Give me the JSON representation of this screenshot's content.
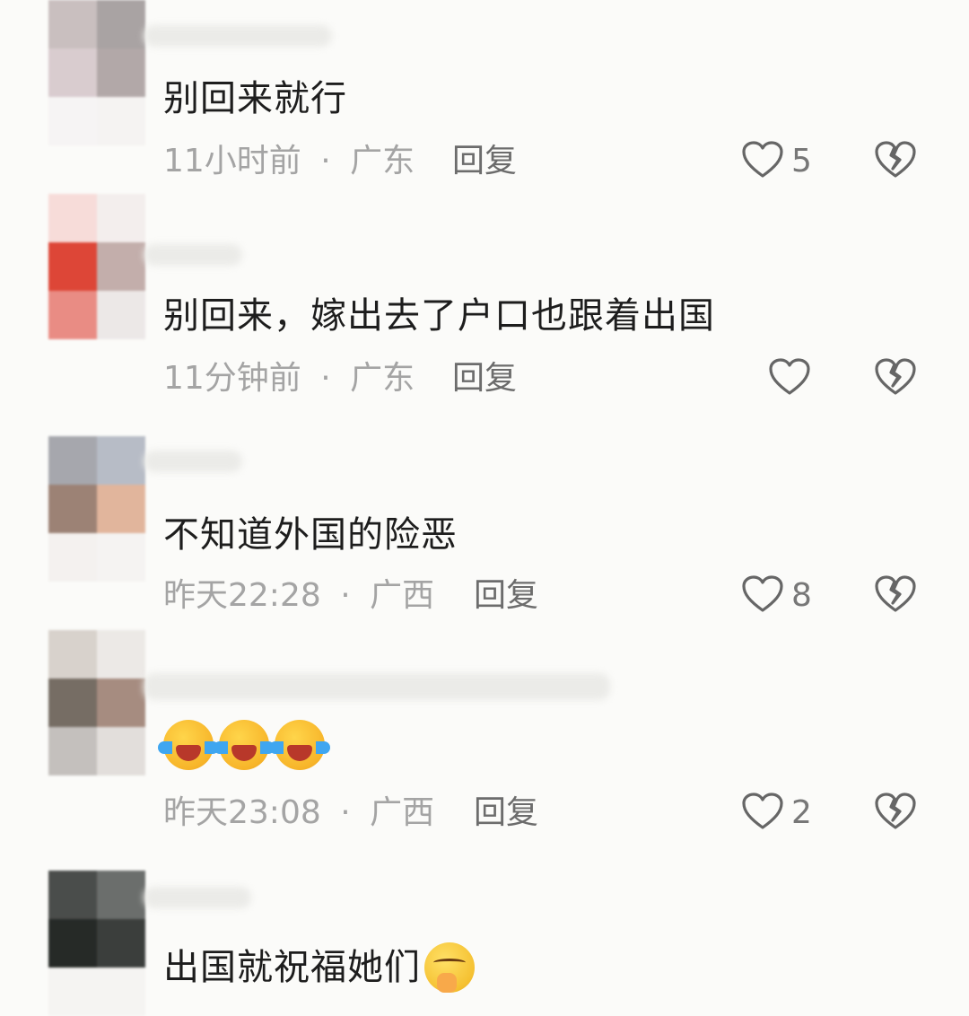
{
  "comments": [
    {
      "text": "别回来就行",
      "time": "11小时前",
      "location": "广东",
      "reply": "回复",
      "likes": "5"
    },
    {
      "text": "别回来，嫁出去了户口也跟着出国",
      "time": "11分钟前",
      "location": "广东",
      "reply": "回复",
      "likes": ""
    },
    {
      "text": "不知道外国的险恶",
      "time": "昨天22:28",
      "location": "广西",
      "reply": "回复",
      "likes": "8"
    },
    {
      "text": "",
      "time": "昨天23:08",
      "location": "广西",
      "reply": "回复",
      "likes": "2"
    },
    {
      "text": "出国就祝福她们",
      "time": "",
      "location": "",
      "reply": "",
      "likes": ""
    }
  ],
  "separator": "·",
  "icons": {
    "like": "heart-outline-icon",
    "dislike": "broken-heart-icon",
    "emoji_cry": "loudly-crying-face-emoji",
    "emoji_shush": "shushing-face-emoji"
  },
  "colors": {
    "background": "#fbfbf9",
    "text": "#1d1d1d",
    "meta": "#a4a4a4",
    "icon": "#666666"
  }
}
